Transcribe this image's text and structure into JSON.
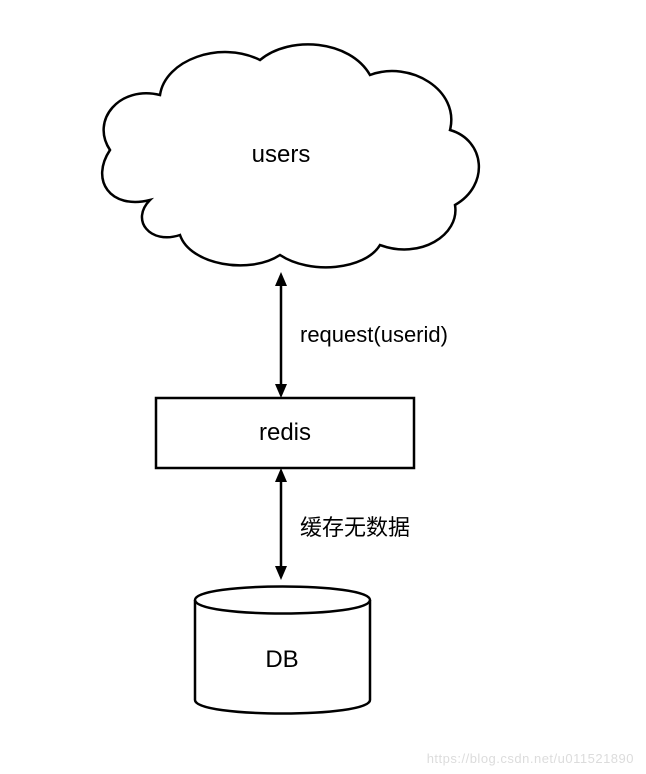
{
  "nodes": {
    "users": {
      "label": "users"
    },
    "redis": {
      "label": "redis"
    },
    "db": {
      "label": "DB"
    }
  },
  "edges": {
    "users_redis": {
      "label": "request(userid)"
    },
    "redis_db": {
      "label": "缓存无数据"
    }
  },
  "watermark": "https://blog.csdn.net/u011521890"
}
